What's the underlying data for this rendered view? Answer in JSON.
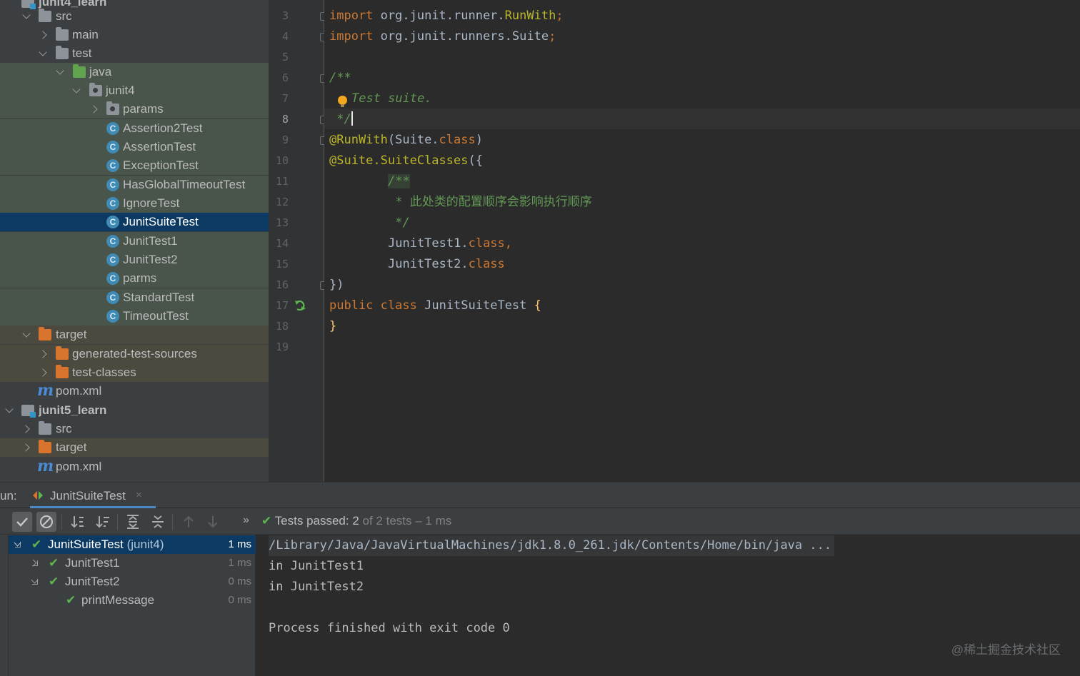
{
  "project_tree": {
    "items": [
      {
        "label": "junit4_learn",
        "icon": "module-icon"
      },
      {
        "label": "src",
        "icon": "folder-icon"
      },
      {
        "label": "main",
        "icon": "folder-icon"
      },
      {
        "label": "test",
        "icon": "folder-icon"
      },
      {
        "label": "java",
        "icon": "test-source-folder-icon"
      },
      {
        "label": "junit4",
        "icon": "package-icon"
      },
      {
        "label": "params",
        "icon": "package-icon"
      },
      {
        "label": "Assertion2Test",
        "icon": "class-icon"
      },
      {
        "label": "AssertionTest",
        "icon": "class-icon"
      },
      {
        "label": "ExceptionTest",
        "icon": "class-icon"
      },
      {
        "label": "HasGlobalTimeoutTest",
        "icon": "class-icon"
      },
      {
        "label": "IgnoreTest",
        "icon": "class-icon"
      },
      {
        "label": "JunitSuiteTest",
        "icon": "class-icon",
        "selected": true
      },
      {
        "label": "JunitTest1",
        "icon": "class-icon"
      },
      {
        "label": "JunitTest2",
        "icon": "class-icon"
      },
      {
        "label": "parms",
        "icon": "class-icon"
      },
      {
        "label": "StandardTest",
        "icon": "class-icon"
      },
      {
        "label": "TimeoutTest",
        "icon": "class-icon"
      },
      {
        "label": "target",
        "icon": "excluded-folder-icon"
      },
      {
        "label": "generated-test-sources",
        "icon": "excluded-folder-icon"
      },
      {
        "label": "test-classes",
        "icon": "excluded-folder-icon"
      },
      {
        "label": "pom.xml",
        "icon": "maven-icon"
      },
      {
        "label": "junit5_learn",
        "icon": "module-icon"
      },
      {
        "label": "src",
        "icon": "folder-icon"
      },
      {
        "label": "target",
        "icon": "excluded-folder-icon"
      },
      {
        "label": "pom.xml",
        "icon": "maven-icon"
      }
    ],
    "class_icon_letter": "C",
    "maven_icon_letter": "m"
  },
  "editor": {
    "current_line": "8",
    "line_numbers": [
      "3",
      "4",
      "5",
      "6",
      "7",
      "8",
      "9",
      "10",
      "11",
      "12",
      "13",
      "14",
      "15",
      "16",
      "17",
      "18",
      "19"
    ],
    "code": {
      "l3_kw": "import",
      "l3_pkg": " org.junit.runner.",
      "l3_cls": "RunWith",
      "l3_end": ";",
      "l4_kw": "import",
      "l4_pkg": " org.junit.runners.",
      "l4_cls": "Suite",
      "l4_end": ";",
      "l6": "/**",
      "l7": "Test suite.",
      "l8": " */",
      "l9_ann": "@RunWith",
      "l9_a": "(Suite.",
      "l9_kw": "class",
      "l9_b": ")",
      "l10_a": "@Suite.",
      "l10_ann": "SuiteClasses",
      "l10_b": "({",
      "l11": "/**",
      "l12": " * 此处类的配置顺序会影响执行顺序",
      "l13": " */",
      "l14_a": "JunitTest1.",
      "l14_kw": "class",
      "l14_b": ",",
      "l15_a": "JunitTest2.",
      "l15_kw": "class",
      "l16": "})",
      "l17_kw1": "public",
      "l17_kw2": "class",
      "l17_name": "JunitSuiteTest",
      "l17_brace": "{",
      "l18": "}"
    }
  },
  "run_panel": {
    "run_label": "un:",
    "tab_title": "JunitSuiteTest",
    "tab_close": "×",
    "status_prefix": "Tests passed: ",
    "status_passed": "2",
    "status_suffix": " of 2 tests – 1 ms",
    "more_glyph": "»",
    "tests": [
      {
        "name": "JunitSuiteTest",
        "pkg": " (junit4)",
        "duration": "1 ms",
        "selected": true
      },
      {
        "name": "JunitTest1",
        "duration": "1 ms"
      },
      {
        "name": "JunitTest2",
        "duration": "0 ms"
      },
      {
        "name": "printMessage",
        "duration": "0 ms"
      }
    ],
    "console": [
      "/Library/Java/JavaVirtualMachines/jdk1.8.0_261.jdk/Contents/Home/bin/java ...",
      "in JunitTest1",
      "in JunitTest2",
      "",
      "Process finished with exit code 0"
    ],
    "watermark": "@稀土掘金技术社区",
    "colors": {
      "passed": "#5fb64f",
      "selection": "#0d3a62",
      "accent": "#4a88c7"
    }
  }
}
